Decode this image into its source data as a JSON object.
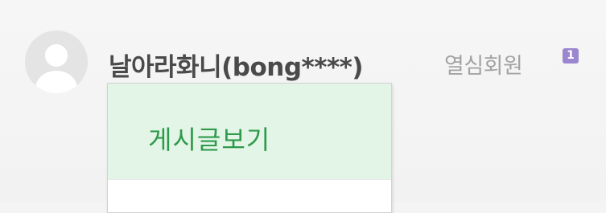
{
  "profile": {
    "nickname": "날아라화니(bong****)",
    "grade": "열심회원",
    "level": "1"
  },
  "menu": {
    "items": [
      {
        "label": "게시글보기"
      }
    ]
  },
  "icons": {
    "avatar": "default-user-avatar"
  },
  "colors": {
    "menu_highlight_bg": "#e3f5e6",
    "menu_highlight_text": "#2f9a4c",
    "level_badge": "#9b87cf"
  }
}
